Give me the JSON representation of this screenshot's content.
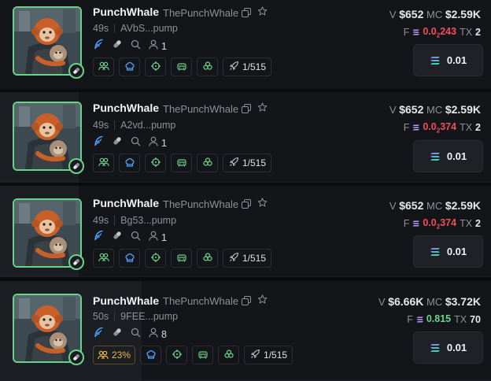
{
  "cards": [
    {
      "name": "PunchWhale",
      "handle": "ThePunchWhale",
      "age": "49s",
      "address": "AVbS...pump",
      "holders": "1",
      "migration_pct": "",
      "progress": "1/515",
      "v_label": "V",
      "volume": "$652",
      "mc_label": "MC",
      "market_cap": "$2.59K",
      "f_label": "F",
      "fee_prefix": "0.0",
      "fee_sub": "2",
      "fee_rest": "243",
      "fee_color": "red",
      "tx_label": "TX",
      "tx": "2",
      "buy_amount": "0.01"
    },
    {
      "name": "PunchWhale",
      "handle": "ThePunchWhale",
      "age": "49s",
      "address": "A2vd...pump",
      "holders": "1",
      "migration_pct": "",
      "progress": "1/515",
      "v_label": "V",
      "volume": "$652",
      "mc_label": "MC",
      "market_cap": "$2.59K",
      "f_label": "F",
      "fee_prefix": "0.0",
      "fee_sub": "2",
      "fee_rest": "374",
      "fee_color": "red",
      "tx_label": "TX",
      "tx": "2",
      "buy_amount": "0.01"
    },
    {
      "name": "PunchWhale",
      "handle": "ThePunchWhale",
      "age": "49s",
      "address": "Bg53...pump",
      "holders": "1",
      "migration_pct": "",
      "progress": "1/515",
      "v_label": "V",
      "volume": "$652",
      "mc_label": "MC",
      "market_cap": "$2.59K",
      "f_label": "F",
      "fee_prefix": "0.0",
      "fee_sub": "2",
      "fee_rest": "374",
      "fee_color": "red",
      "tx_label": "TX",
      "tx": "2",
      "buy_amount": "0.01"
    },
    {
      "name": "PunchWhale",
      "handle": "ThePunchWhale",
      "age": "50s",
      "address": "9FEE...pump",
      "holders": "8",
      "migration_pct": "23%",
      "progress": "1/515",
      "v_label": "V",
      "volume": "$6.66K",
      "mc_label": "MC",
      "market_cap": "$3.72K",
      "f_label": "F",
      "fee_prefix": "0.815",
      "fee_sub": "",
      "fee_rest": "",
      "fee_color": "green",
      "tx_label": "TX",
      "tx": "70",
      "buy_amount": "0.01"
    }
  ],
  "icons": {
    "social": "pen-feather-icon",
    "pill": "pill-icon",
    "search": "search-icon",
    "holders": "user-icon",
    "copy": "copy-icon",
    "star": "star-icon",
    "sol": "solana-icon",
    "rocket": "rocket-icon"
  },
  "colors": {
    "accent_green": "#6ad38a",
    "danger_red": "#ef4e5c",
    "warn_orange": "#f4b740",
    "blue": "#4aa3ff"
  }
}
